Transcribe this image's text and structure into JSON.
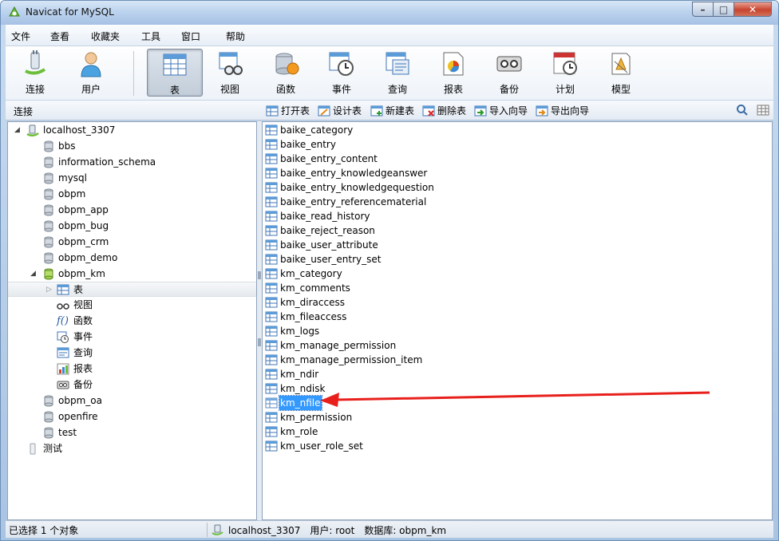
{
  "window": {
    "title": "Navicat for MySQL"
  },
  "menu": [
    "文件",
    "查看",
    "收藏夹",
    "工具",
    "窗口",
    "帮助"
  ],
  "toolbar": {
    "connect": "连接",
    "user": "用户",
    "table": "表",
    "view": "视图",
    "function": "函数",
    "event": "事件",
    "query": "查询",
    "report": "报表",
    "backup": "备份",
    "schedule": "计划",
    "model": "模型"
  },
  "objbar": {
    "section_label": "连接",
    "open_table": "打开表",
    "design_table": "设计表",
    "new_table": "新建表",
    "delete_table": "删除表",
    "import_wizard": "导入向导",
    "export_wizard": "导出向导"
  },
  "tree": {
    "connection": "localhost_3307",
    "databases": [
      "bbs",
      "information_schema",
      "mysql",
      "obpm",
      "obpm_app",
      "obpm_bug",
      "obpm_crm",
      "obpm_demo"
    ],
    "open_db": "obpm_km",
    "children": [
      "表",
      "视图",
      "函数",
      "事件",
      "查询",
      "报表",
      "备份"
    ],
    "databases_after": [
      "obpm_oa",
      "openfire",
      "test"
    ],
    "other_connection": "测试"
  },
  "tables": [
    "baike_category",
    "baike_entry",
    "baike_entry_content",
    "baike_entry_knowledgeanswer",
    "baike_entry_knowledgequestion",
    "baike_entry_referencematerial",
    "baike_read_history",
    "baike_reject_reason",
    "baike_user_attribute",
    "baike_user_entry_set",
    "km_category",
    "km_comments",
    "km_diraccess",
    "km_fileaccess",
    "km_logs",
    "km_manage_permission",
    "km_manage_permission_item",
    "km_ndir",
    "km_ndisk",
    "km_nfile",
    "km_permission",
    "km_role",
    "km_user_role_set"
  ],
  "selected_table": "km_nfile",
  "status": {
    "selection": "已选择 1 个对象",
    "connection": "localhost_3307",
    "user": "用户: root",
    "database": "数据库: obpm_km"
  },
  "colors": {
    "selection": "#3399ff",
    "arrow": "#e8201c",
    "titlebar": "#bcd3ee"
  }
}
